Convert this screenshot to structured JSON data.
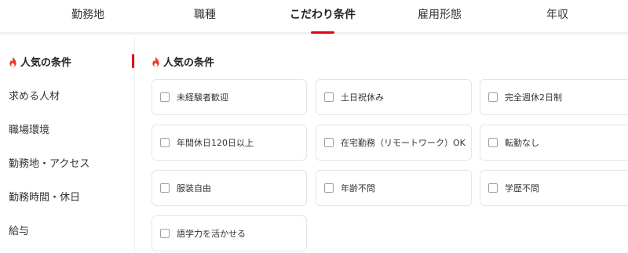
{
  "tabs": [
    {
      "label": "勤務地"
    },
    {
      "label": "職種"
    },
    {
      "label": "こだわり条件"
    },
    {
      "label": "雇用形態"
    },
    {
      "label": "年収"
    }
  ],
  "active_tab": "こだわり条件",
  "sidebar": {
    "items": [
      {
        "label": "人気の条件"
      },
      {
        "label": "求める人材"
      },
      {
        "label": "職場環境"
      },
      {
        "label": "勤務地・アクセス"
      },
      {
        "label": "勤務時間・休日"
      },
      {
        "label": "給与"
      }
    ]
  },
  "section": {
    "title": "人気の条件"
  },
  "options": [
    {
      "label": "未経験者歓迎",
      "checked": false
    },
    {
      "label": "土日祝休み",
      "checked": false
    },
    {
      "label": "完全週休2日制",
      "checked": false
    },
    {
      "label": "年間休日120日以上",
      "checked": false
    },
    {
      "label": "在宅勤務（リモートワーク）OK",
      "checked": false
    },
    {
      "label": "転勤なし",
      "checked": false
    },
    {
      "label": "服装自由",
      "checked": false
    },
    {
      "label": "年齢不問",
      "checked": false
    },
    {
      "label": "学歴不問",
      "checked": false
    },
    {
      "label": "語学力を活かせる",
      "checked": false
    }
  ],
  "colors": {
    "accent": "#e60012",
    "flame": "#e8382f",
    "border": "#e3e5e8"
  },
  "icons": {
    "popular": "flame-icon",
    "checkbox": "checkbox-icon"
  }
}
